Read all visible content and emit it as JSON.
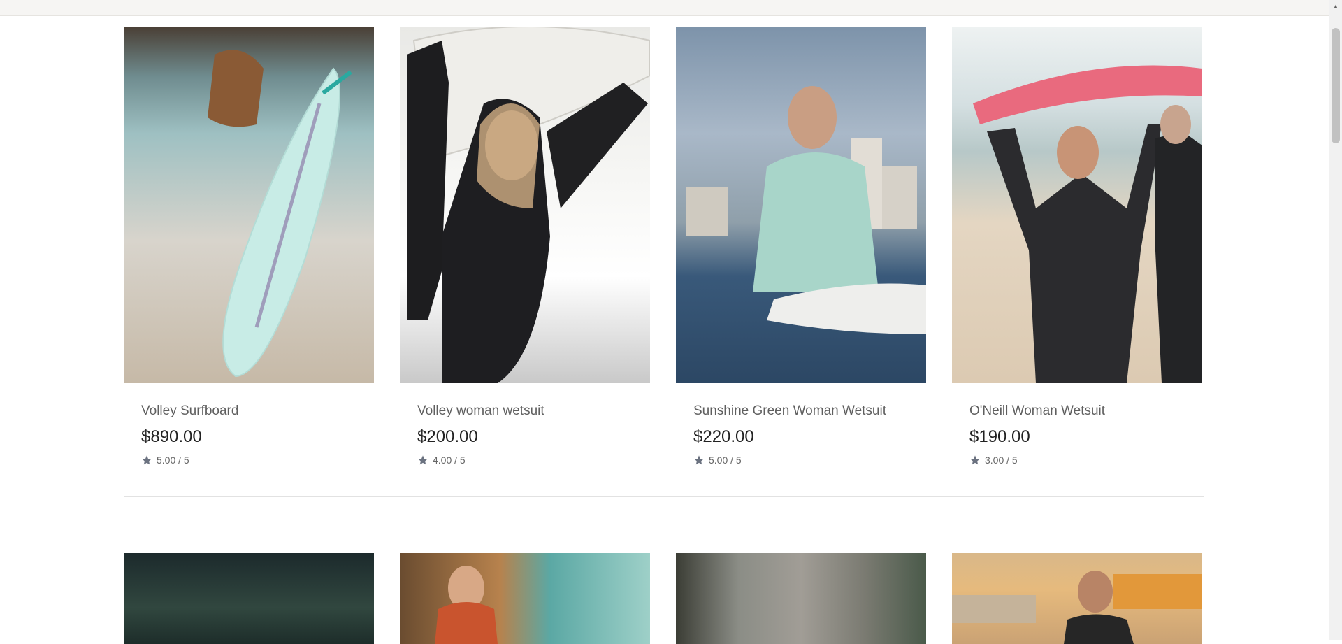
{
  "products": [
    {
      "name": "Volley Surfboard",
      "price": "$890.00",
      "rating": "5.00 / 5"
    },
    {
      "name": "Volley woman wetsuit",
      "price": "$200.00",
      "rating": "4.00 / 5"
    },
    {
      "name": "Sunshine Green Woman Wetsuit",
      "price": "$220.00",
      "rating": "5.00 / 5"
    },
    {
      "name": "O'Neill Woman Wetsuit",
      "price": "$190.00",
      "rating": "3.00 / 5"
    }
  ],
  "icons": {
    "rating": "star-icon",
    "scroll_up": "chevron-up-icon"
  }
}
